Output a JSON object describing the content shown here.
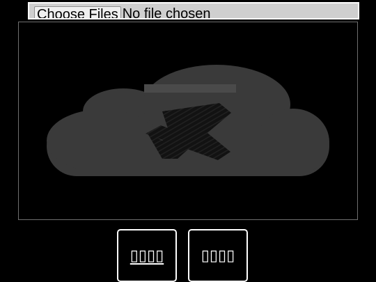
{
  "file_input": {
    "button_label": "Choose Files",
    "status_text": "No file chosen"
  },
  "preview": {
    "icon": "cloud-error-icon"
  },
  "actions": {
    "primary_label": "▯▯▯▯",
    "secondary_label": "▯▯▯▯"
  },
  "colors": {
    "background": "#000000",
    "cloud": "#3a3a3a",
    "cross": "#121212",
    "border": "#ffffff"
  }
}
